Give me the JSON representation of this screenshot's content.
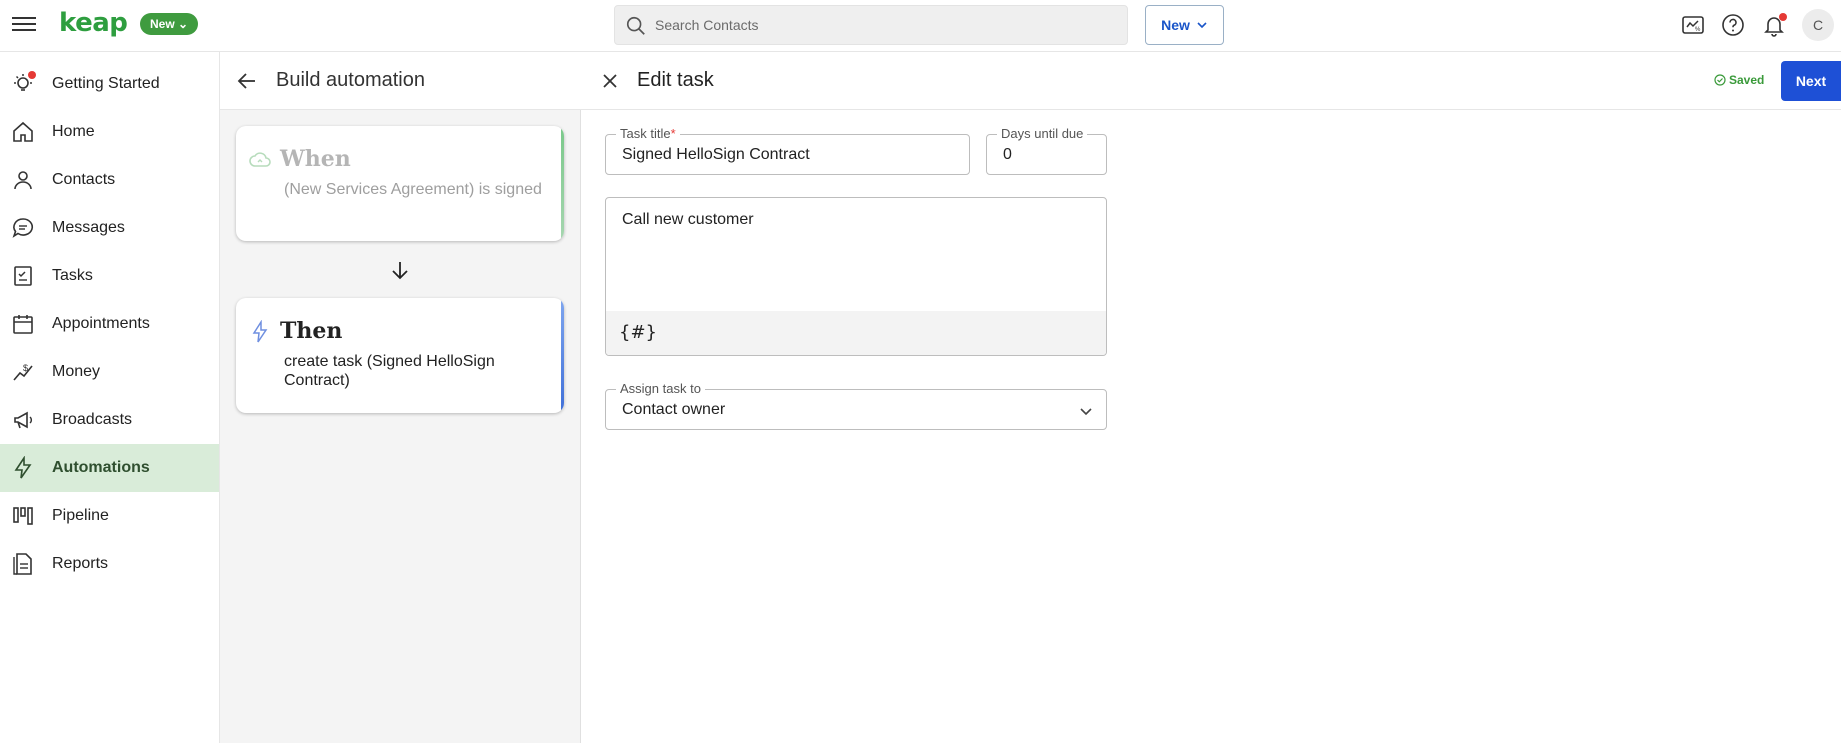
{
  "app": {
    "logo": "keap",
    "new_pill": "New",
    "search_placeholder": "Search Contacts",
    "new_button": "New",
    "avatar_letter": "C"
  },
  "sidebar": {
    "items": [
      {
        "label": "Getting Started",
        "icon": "lightbulb-icon"
      },
      {
        "label": "Home",
        "icon": "home-icon"
      },
      {
        "label": "Contacts",
        "icon": "person-icon"
      },
      {
        "label": "Messages",
        "icon": "chat-icon"
      },
      {
        "label": "Tasks",
        "icon": "checklist-icon"
      },
      {
        "label": "Appointments",
        "icon": "calendar-icon"
      },
      {
        "label": "Money",
        "icon": "money-icon"
      },
      {
        "label": "Broadcasts",
        "icon": "megaphone-icon"
      },
      {
        "label": "Automations",
        "icon": "bolt-icon",
        "active": true
      },
      {
        "label": "Pipeline",
        "icon": "pipeline-icon"
      },
      {
        "label": "Reports",
        "icon": "report-icon"
      }
    ]
  },
  "builder": {
    "title": "Build automation",
    "when": {
      "heading": "When",
      "body": "(New Services Agreement) is signed"
    },
    "then": {
      "heading": "Then",
      "body": "create task (Signed HelloSign Contract)"
    }
  },
  "editor": {
    "title": "Edit task",
    "saved": "Saved",
    "next": "Next",
    "task_title_label": "Task title",
    "task_title_required": "*",
    "task_title_value": "Signed HelloSign Contract",
    "days_label": "Days until due",
    "days_value": "0",
    "description_value": "Call new customer",
    "merge_field_button": "{#}",
    "assign_label": "Assign task to",
    "assign_value": "Contact owner"
  },
  "colors": {
    "brand_green": "#2e9e3f",
    "active_nav_bg": "#d9ecd9",
    "primary_blue": "#1e50d6",
    "notification_red": "#e53935"
  }
}
